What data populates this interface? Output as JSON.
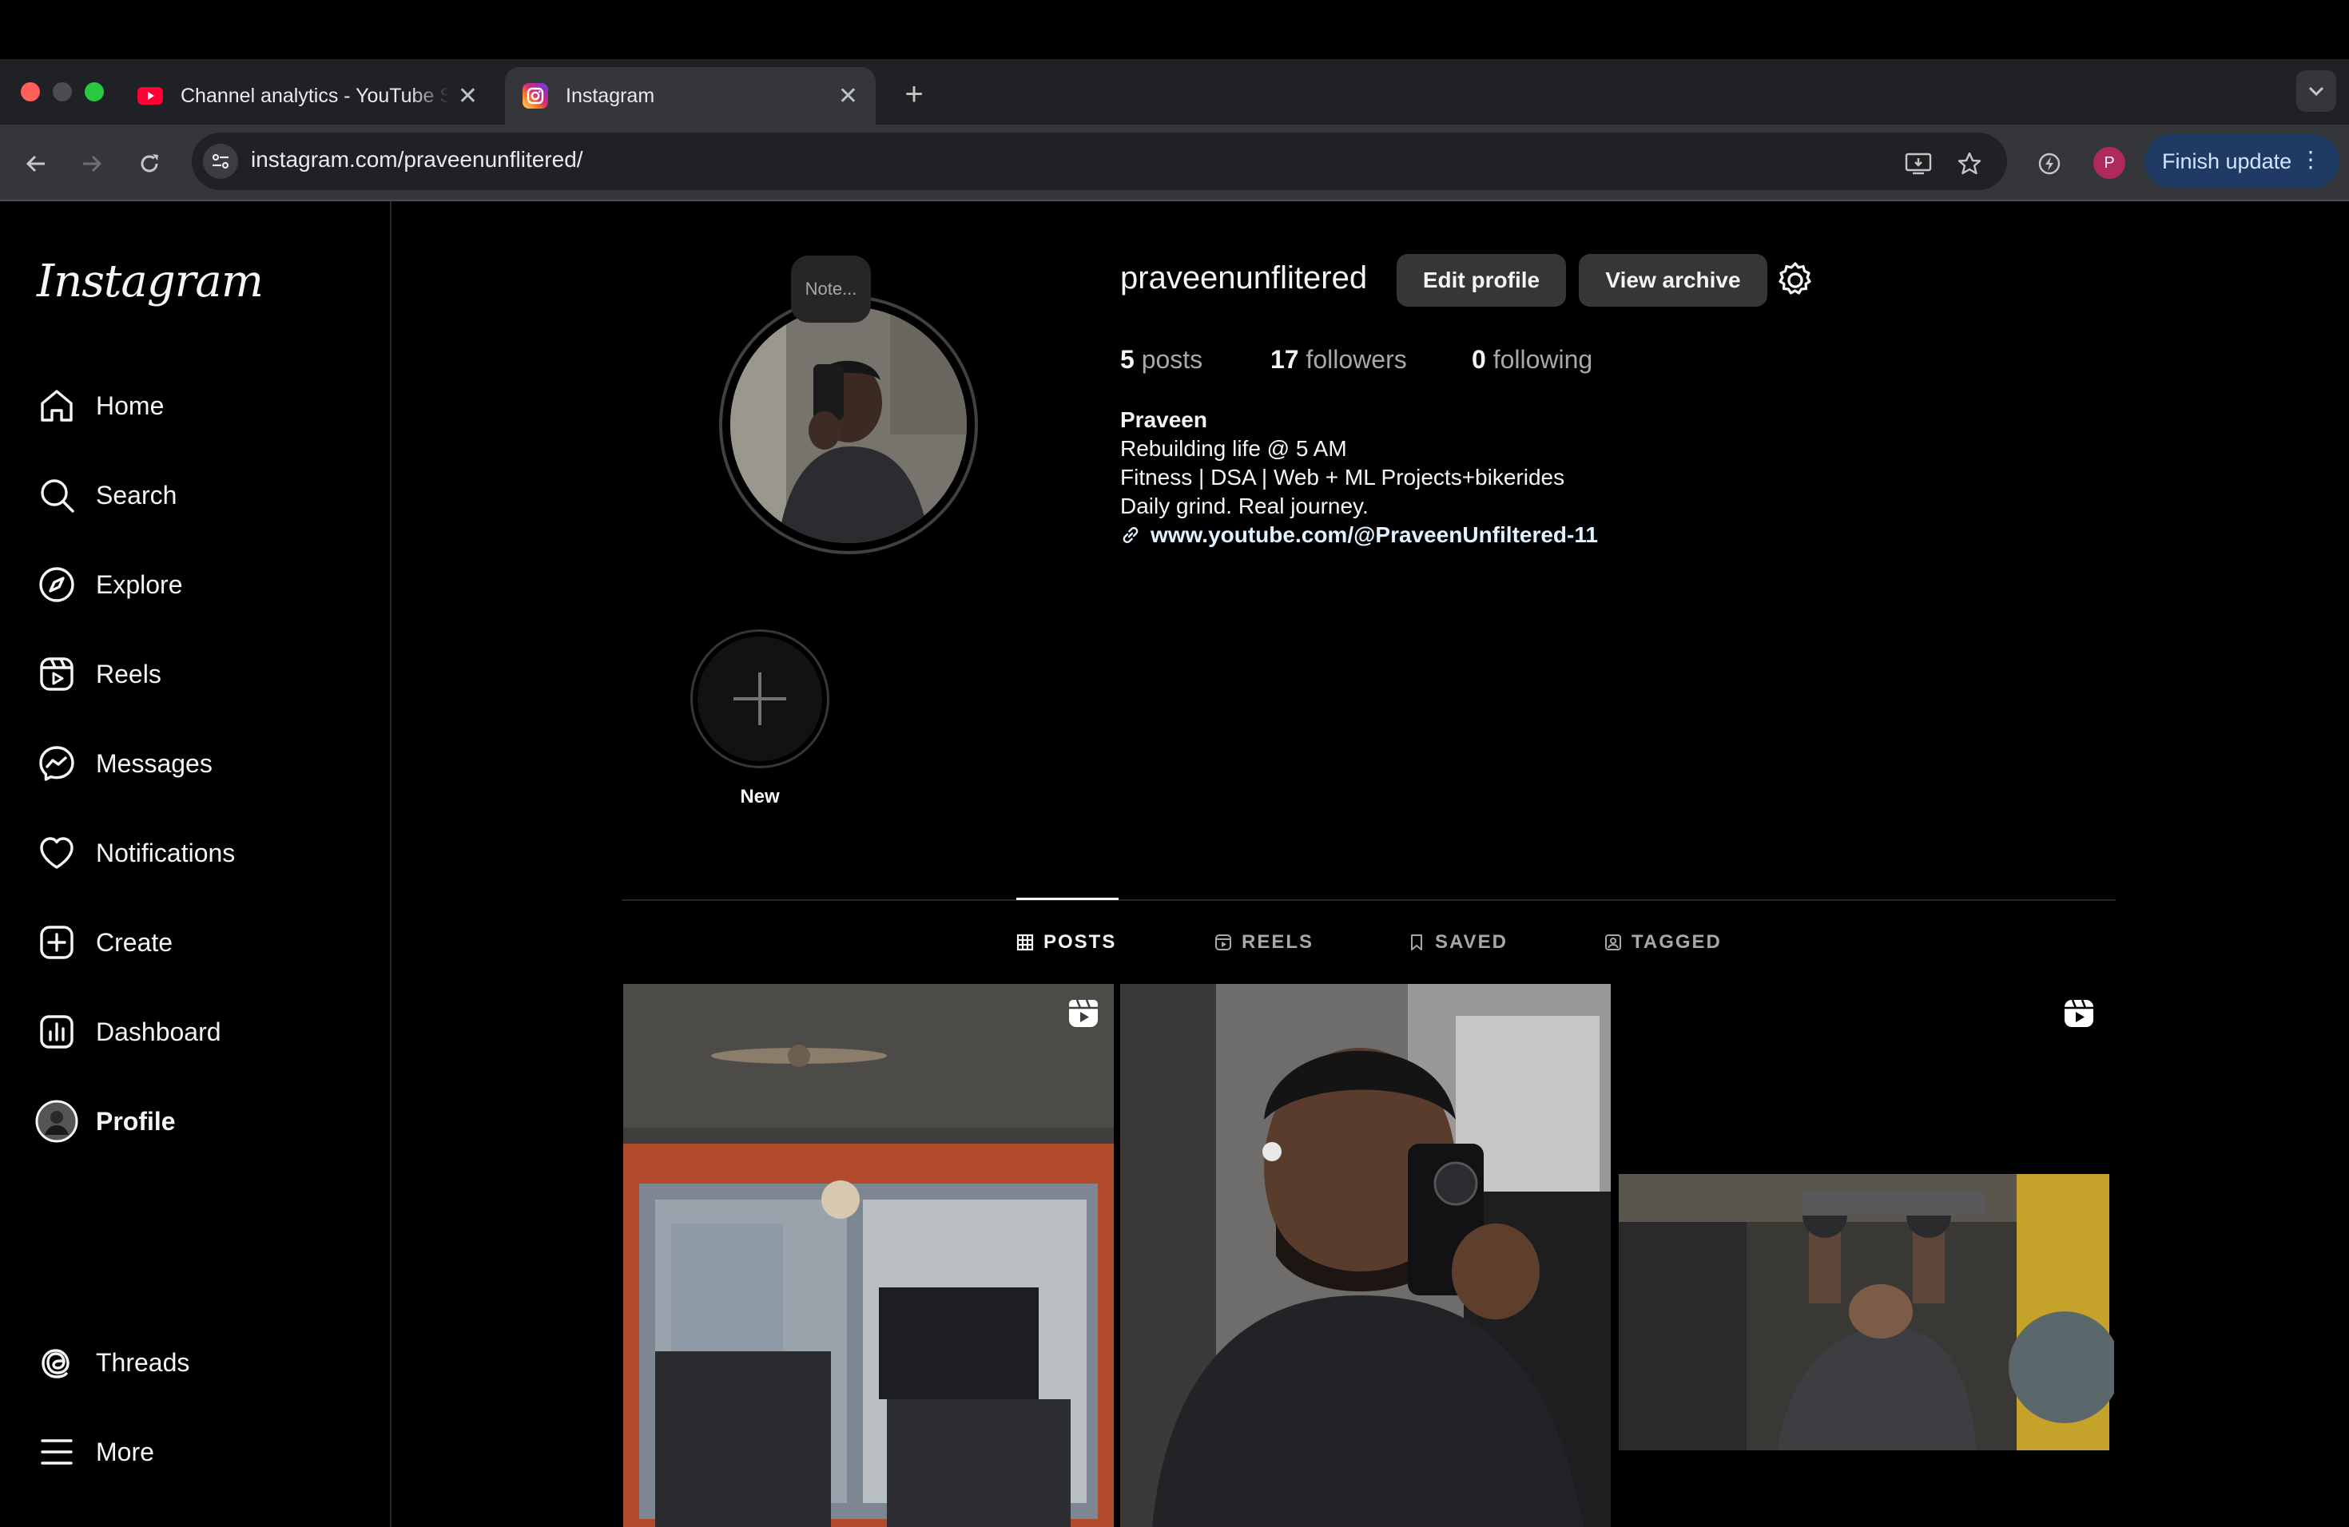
{
  "browser": {
    "tabs": [
      {
        "title": "Channel analytics - YouTube Studio",
        "favicon": "youtube-icon",
        "active": false
      },
      {
        "title": "Instagram",
        "favicon": "instagram-icon",
        "active": true
      }
    ],
    "url": "instagram.com/praveenunflitered/",
    "profile_initial": "P",
    "update_button": "Finish update"
  },
  "sidebar": {
    "logo": "Instagram",
    "items": [
      {
        "label": "Home",
        "icon": "home-icon"
      },
      {
        "label": "Search",
        "icon": "search-icon"
      },
      {
        "label": "Explore",
        "icon": "compass-icon"
      },
      {
        "label": "Reels",
        "icon": "reels-icon"
      },
      {
        "label": "Messages",
        "icon": "messenger-icon"
      },
      {
        "label": "Notifications",
        "icon": "heart-icon"
      },
      {
        "label": "Create",
        "icon": "plus-square-icon"
      },
      {
        "label": "Dashboard",
        "icon": "dashboard-icon"
      },
      {
        "label": "Profile",
        "icon": "avatar-icon"
      }
    ],
    "bottom_items": [
      {
        "label": "Threads",
        "icon": "threads-icon"
      },
      {
        "label": "More",
        "icon": "menu-icon"
      }
    ]
  },
  "profile": {
    "note_placeholder": "Note...",
    "username": "praveenunflitered",
    "edit_button": "Edit profile",
    "archive_button": "View archive",
    "stats": {
      "posts_count": "5",
      "posts_label": "posts",
      "followers_count": "17",
      "followers_label": "followers",
      "following_count": "0",
      "following_label": "following"
    },
    "bio": {
      "name": "Praveen",
      "lines": [
        "Rebuilding life @ 5 AM",
        "Fitness | DSA | Web + ML Projects+bikerides",
        "Daily grind. Real journey."
      ],
      "link": "www.youtube.com/@PraveenUnfiltered-11"
    },
    "highlight_new_label": "New"
  },
  "content_tabs": [
    {
      "label": "POSTS",
      "icon": "grid-icon",
      "active": true
    },
    {
      "label": "REELS",
      "icon": "reels-icon",
      "active": false
    },
    {
      "label": "SAVED",
      "icon": "bookmark-icon",
      "active": false
    },
    {
      "label": "TAGGED",
      "icon": "tag-user-icon",
      "active": false
    }
  ],
  "colors": {
    "background": "#000000",
    "text_primary": "#f5f5f5",
    "text_secondary": "#a8a8a8",
    "button_bg": "#363636",
    "link": "#e0f1ff",
    "chrome_update": "#1f3b63"
  }
}
